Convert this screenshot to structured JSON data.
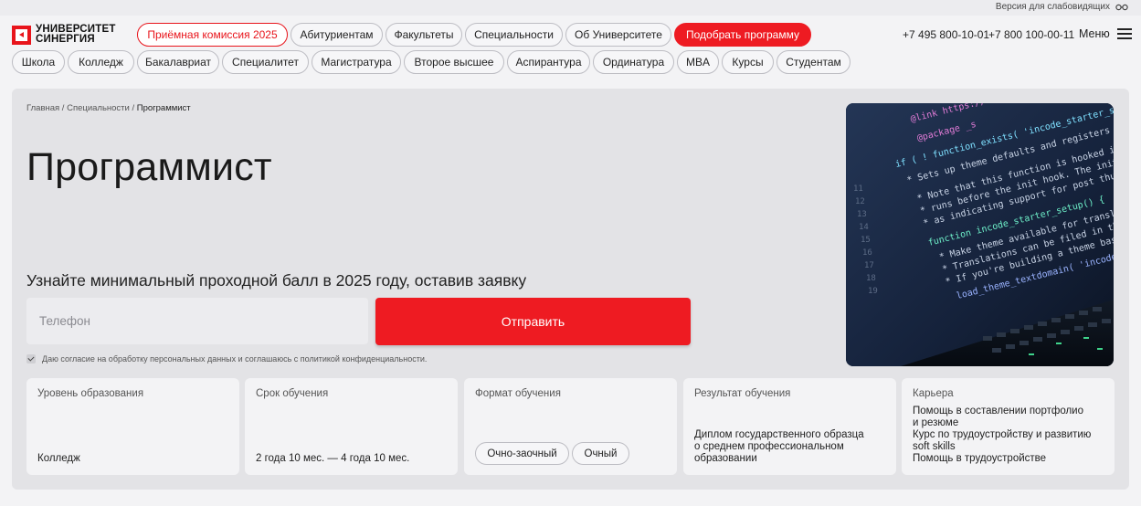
{
  "topbar": {
    "vision_label": "Версия для слабовидящих"
  },
  "logo": {
    "line1": "УНИВЕРСИТЕТ",
    "line2": "СИНЕРГИЯ"
  },
  "nav_row1": [
    "Приёмная комиссия 2025",
    "Абитуриентам",
    "Факультеты",
    "Специальности",
    "Об Университете",
    "Подобрать программу"
  ],
  "phones": [
    "+7 495 800-10-01",
    "+7 800 100-00-11"
  ],
  "menu_label": "Меню",
  "nav_row2": [
    "Школа",
    "Колледж",
    "Бакалавриат",
    "Специалитет",
    "Магистратура",
    "Второе высшее",
    "Аспирантура",
    "Ординатура",
    "MBA",
    "Курсы",
    "Студентам"
  ],
  "breadcrumb": {
    "home": "Главная",
    "section": "Специальности",
    "current": "Программист",
    "sep": " / "
  },
  "title": "Программист",
  "form": {
    "subtitle": "Узнайте минимальный проходной балл в 2025 году, оставив заявку",
    "phone_placeholder": "Телефон",
    "submit_label": "Отправить",
    "consent": "Даю согласие на обработку персональных данных и соглашаюсь c политикой конфиденциальности."
  },
  "code_lines": [
    "@link https://...",
    "@package _s",
    "if ( ! function_exists( 'incode_starter_setup' ) ) :",
    "* Sets up theme defaults and registers support",
    "* Note that this function is hooked into the",
    "* runs before the init hook. The init hook is",
    "* as indicating support for post thumbnails.",
    "function incode_starter_setup() {",
    "* Make theme available for translation",
    "* Translations can be filed in the /lang",
    "* If you're building a theme based on",
    "load_theme_textdomain( 'incode' );"
  ],
  "line_numbers": [
    "11",
    "12",
    "13",
    "14",
    "15",
    "16",
    "17",
    "18",
    "19"
  ],
  "cards": [
    {
      "label": "Уровень образования",
      "value": [
        "Колледж"
      ]
    },
    {
      "label": "Срок обучения",
      "value": [
        "2 года 10 мес. — 4 года 10 мес."
      ]
    },
    {
      "label": "Формат обучения",
      "options": [
        "Очно-заочный",
        "Очный"
      ]
    },
    {
      "label": "Результат обучения",
      "value": [
        "Диплом государственного образца",
        "о среднем профессиональном",
        "образовании"
      ]
    },
    {
      "label": "Карьера",
      "value": [
        "Помощь в составлении портфолио",
        "и резюме",
        "Курс по трудоустройству и развитию",
        "soft skills",
        "Помощь в трудоустройстве"
      ]
    }
  ],
  "colors": {
    "brand_red": "#ee1b22",
    "hero_bg": "#e3e3e6"
  }
}
